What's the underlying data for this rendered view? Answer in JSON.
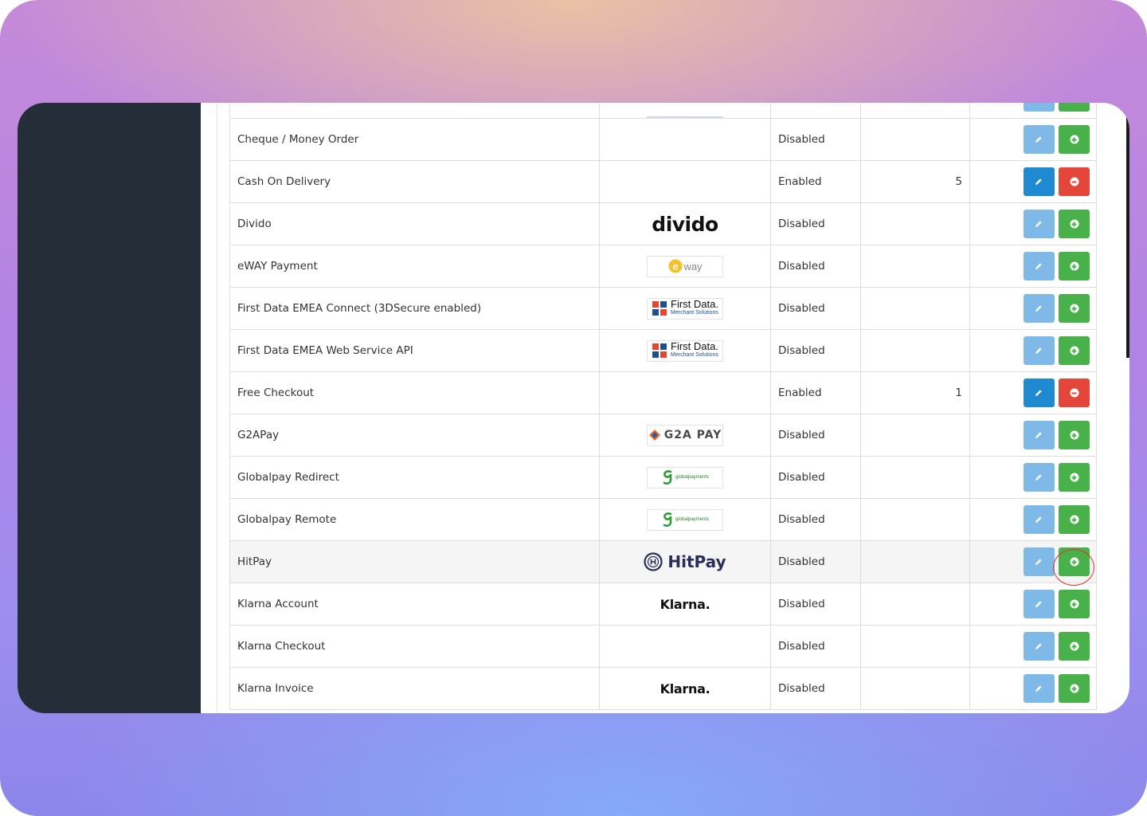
{
  "colors": {
    "sidebar_bg": "#252d38",
    "edit_disabled": "#7fb9e8",
    "edit_enabled": "#1f8ad1",
    "install": "#49b149",
    "uninstall": "#e4473a",
    "highlight_ring": "#e0312a"
  },
  "rows": [
    {
      "name": "",
      "logo": "logo-partial",
      "status": "",
      "order": "",
      "state": "disabled"
    },
    {
      "name": "Cheque / Money Order",
      "logo": "",
      "status": "Disabled",
      "order": "",
      "state": "disabled"
    },
    {
      "name": "Cash On Delivery",
      "logo": "",
      "status": "Enabled",
      "order": "5",
      "state": "enabled"
    },
    {
      "name": "Divido",
      "logo": "divido",
      "logo_text": "divido",
      "status": "Disabled",
      "order": "",
      "state": "disabled"
    },
    {
      "name": "eWAY Payment",
      "logo": "eway",
      "logo_text": "way",
      "status": "Disabled",
      "order": "",
      "state": "disabled"
    },
    {
      "name": "First Data EMEA Connect (3DSecure enabled)",
      "logo": "firstdata",
      "logo_text": "First Data.",
      "logo_sub": "Merchant Solutions",
      "status": "Disabled",
      "order": "",
      "state": "disabled"
    },
    {
      "name": "First Data EMEA Web Service API",
      "logo": "firstdata",
      "logo_text": "First Data.",
      "logo_sub": "Merchant Solutions",
      "status": "Disabled",
      "order": "",
      "state": "disabled"
    },
    {
      "name": "Free Checkout",
      "logo": "",
      "status": "Enabled",
      "order": "1",
      "state": "enabled"
    },
    {
      "name": "G2APay",
      "logo": "g2a",
      "logo_text": "G2A PAY",
      "status": "Disabled",
      "order": "",
      "state": "disabled"
    },
    {
      "name": "Globalpay Redirect",
      "logo": "globalpay",
      "logo_text": "globalpayments",
      "status": "Disabled",
      "order": "",
      "state": "disabled"
    },
    {
      "name": "Globalpay Remote",
      "logo": "globalpay",
      "logo_text": "globalpayments",
      "status": "Disabled",
      "order": "",
      "state": "disabled"
    },
    {
      "name": "HitPay",
      "logo": "hitpay",
      "logo_text": "HitPay",
      "status": "Disabled",
      "order": "",
      "state": "disabled",
      "highlight": true
    },
    {
      "name": "Klarna Account",
      "logo": "klarna",
      "logo_text": "Klarna.",
      "status": "Disabled",
      "order": "",
      "state": "disabled"
    },
    {
      "name": "Klarna Checkout",
      "logo": "",
      "status": "Disabled",
      "order": "",
      "state": "disabled"
    },
    {
      "name": "Klarna Invoice",
      "logo": "klarna",
      "logo_text": "Klarna.",
      "status": "Disabled",
      "order": "",
      "state": "disabled"
    }
  ]
}
